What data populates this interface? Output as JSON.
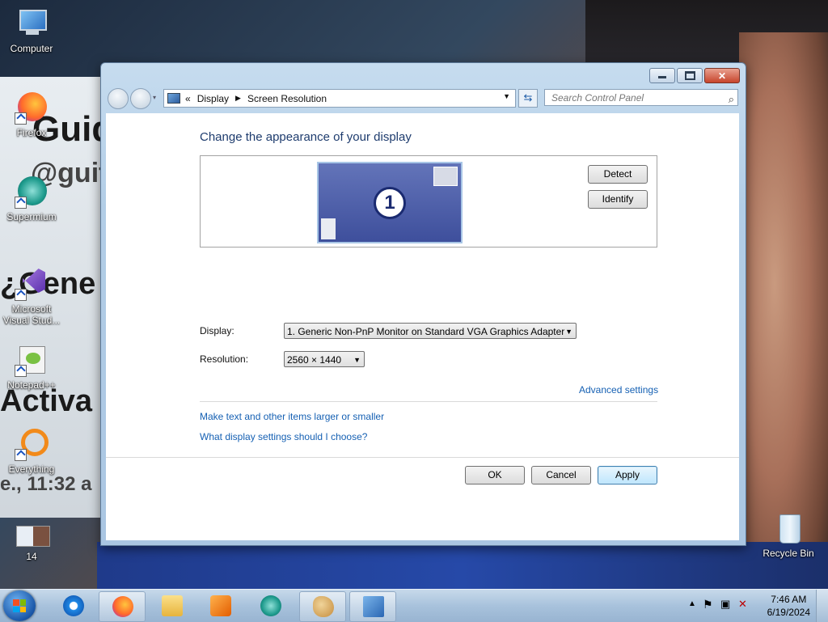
{
  "desktop": {
    "icons": [
      {
        "label": "Computer",
        "icon": "computer-icon"
      },
      {
        "label": "Firefox",
        "icon": "firefox-icon"
      },
      {
        "label": "Supermium",
        "icon": "supermium-icon"
      },
      {
        "label": "Microsoft Visual Stud...",
        "icon": "visual-studio-icon"
      },
      {
        "label": "Notepad++",
        "icon": "notepadpp-icon"
      },
      {
        "label": "Everything",
        "icon": "everything-icon"
      },
      {
        "label": "14",
        "icon": "video-thumbnail-icon"
      },
      {
        "label": "Recycle Bin",
        "icon": "recycle-bin-icon"
      }
    ],
    "wallpaper_text": [
      "Guid",
      "@guit",
      "¿Gene",
      "Activa",
      "e., 11:32 a"
    ]
  },
  "window": {
    "breadcrumb": {
      "prefix": "«",
      "items": [
        "Display",
        "Screen Resolution"
      ]
    },
    "search_placeholder": "Search Control Panel",
    "title": "Change the appearance of your display",
    "monitor_number": "1",
    "detect_label": "Detect",
    "identify_label": "Identify",
    "display_label": "Display:",
    "display_value": "1. Generic Non-PnP Monitor on Standard VGA Graphics Adapter",
    "resolution_label": "Resolution:",
    "resolution_value": "2560 × 1440",
    "advanced_link": "Advanced settings",
    "link_text_size": "Make text and other items larger or smaller",
    "link_which_settings": "What display settings should I choose?",
    "ok_label": "OK",
    "cancel_label": "Cancel",
    "apply_label": "Apply"
  },
  "taskbar": {
    "items": [
      "start-orb",
      "internet-explorer-icon",
      "firefox-icon",
      "file-explorer-icon",
      "media-player-icon",
      "supermium-icon",
      "paint-icon",
      "control-panel-display-icon"
    ],
    "time": "7:46 AM",
    "date": "6/19/2024"
  },
  "colors": {
    "accent_link": "#1560b3",
    "title": "#1e3c6e",
    "monitor": "#4e5fa8"
  }
}
